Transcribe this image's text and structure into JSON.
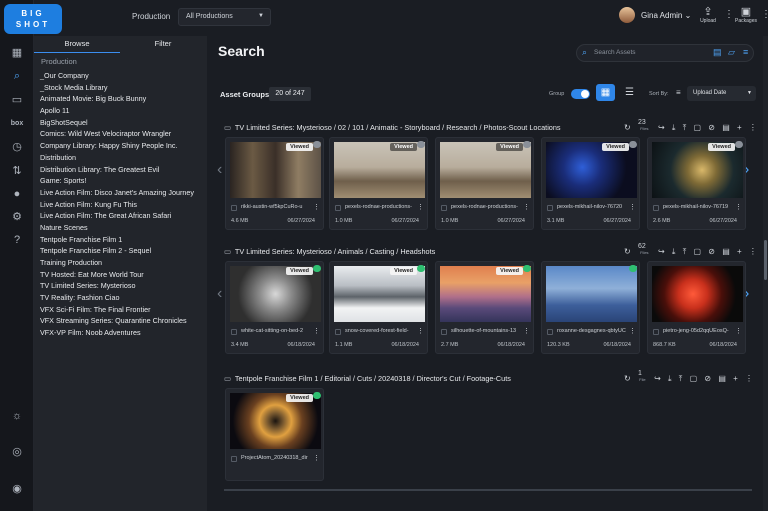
{
  "app": {
    "logo_text": "BIG SHOT"
  },
  "nav_icons": [
    "grid-icon",
    "search-icon",
    "inbox-icon",
    "box-icon",
    "clock-icon",
    "transfer-icon",
    "user-icon",
    "gear-icon",
    "help-icon",
    "sun-icon",
    "hub-icon",
    "account-icon"
  ],
  "topbar": {
    "production_label": "Production",
    "production_value": "All Productions",
    "user_name": "Gina Admin",
    "upload_label": "Upload",
    "packages_label": "Packages"
  },
  "sidebar": {
    "tabs": [
      {
        "label": "Browse",
        "active": true
      },
      {
        "label": "Filter",
        "active": false
      }
    ],
    "section_label": "Production",
    "items": [
      "_Our Company",
      "_Stock Media Library",
      "Animated Movie: Big Buck Bunny",
      "Apollo 11",
      "BigShotSequel",
      "Comics: Wild West Velociraptor Wrangler",
      "Company Library: Happy Shiny People Inc.",
      "Distribution",
      "Distribution Library: The Greatest Evil",
      "Game: Sports!",
      "Live Action Film: Disco Janet's Amazing Journey",
      "Live Action Film: Kung Fu This",
      "Live Action Film: The Great African Safari",
      "Nature Scenes",
      "Tentpole Franchise Film 1",
      "Tentpole Franchise Film 2 - Sequel",
      "Training Production",
      "TV Hosted: Eat More World Tour",
      "TV Limited Series: Mysterioso",
      "TV Reality: Fashion Ciao",
      "VFX Sci-Fi Film: The Final Frontier",
      "VFX Streaming Series: Quarantine Chronicles",
      "VFX-VP Film: Noob Adventures"
    ]
  },
  "main": {
    "title": "Search",
    "search_placeholder": "Search Assets",
    "asset_groups_label": "Asset Groups",
    "asset_groups_count": "20 of 247",
    "group_label": "Group",
    "group_toggle_on": true,
    "sort_by_label": "Sort By:",
    "sort_value": "Upload Date",
    "accent_color": "#2f86e8",
    "groups": [
      {
        "path": "TV Limited Series: Mysterioso / 02 / 101 / Animatic - Storyboard / Research / Photos-Scout Locations",
        "file_count": "23",
        "files_label": "Files",
        "cards": [
          {
            "name": "rikki-austin-wf5kpCuRo-u",
            "size": "4.6 MB",
            "date": "06/27/2024",
            "viewed": "Viewed"
          },
          {
            "name": "pexels-rodnae-productions-",
            "size": "1.0 MB",
            "date": "06/27/2024",
            "viewed": "Viewed"
          },
          {
            "name": "pexels-rodnae-productions-",
            "size": "1.0 MB",
            "date": "06/27/2024",
            "viewed": "Viewed"
          },
          {
            "name": "pexels-mikhail-nilov-76720",
            "size": "3.1 MB",
            "date": "06/27/2024",
            "viewed": "Viewed"
          },
          {
            "name": "pexels-mikhail-nilov-76719",
            "size": "2.6 MB",
            "date": "06/27/2024",
            "viewed": "Viewed"
          }
        ]
      },
      {
        "path": "TV Limited Series: Mysterioso / Animals / Casting / Headshots",
        "file_count": "62",
        "files_label": "Files",
        "cards": [
          {
            "name": "white-cat-sitting-on-bed-2",
            "size": "3.4 MB",
            "date": "06/18/2024",
            "viewed": "Viewed"
          },
          {
            "name": "snow-covered-forest-field-",
            "size": "1.1 MB",
            "date": "06/18/2024",
            "viewed": "Viewed"
          },
          {
            "name": "silhouette-of-mountains-13",
            "size": "2.7 MB",
            "date": "06/18/2024",
            "viewed": "Viewed"
          },
          {
            "name": "roxanne-desgagnes-qbtyUC",
            "size": "120.3 KB",
            "date": "06/18/2024",
            "viewed": ""
          },
          {
            "name": "pietro-jeng-05d2qqUEosQ-",
            "size": "868.7 KB",
            "date": "06/18/2024",
            "viewed": ""
          }
        ]
      },
      {
        "path": "Tentpole Franchise Film 1 / Editorial / Cuts / 20240318 / Director's Cut / Footage-Cuts",
        "file_count": "1",
        "files_label": "File",
        "cards": [
          {
            "name": "ProjectAtom_20240318_dir",
            "size": "",
            "date": "",
            "viewed": "Viewed"
          }
        ]
      }
    ]
  }
}
